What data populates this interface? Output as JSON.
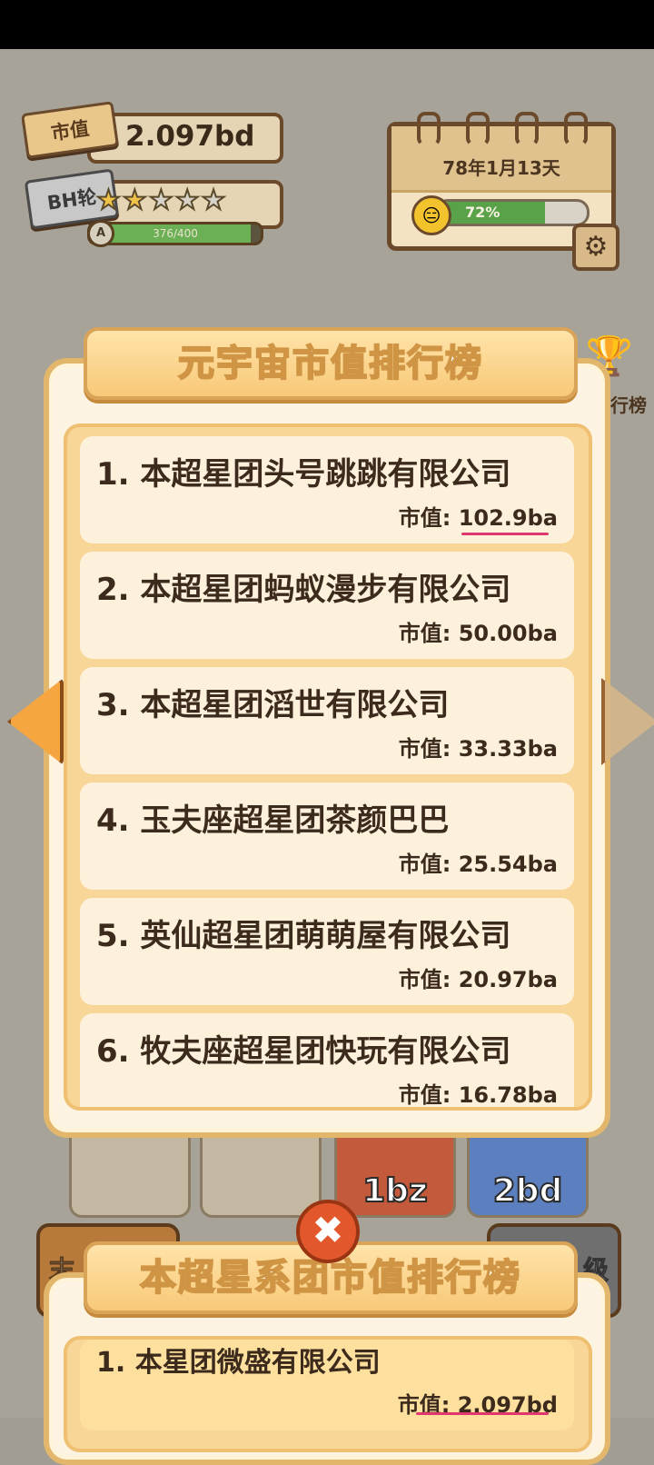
{
  "hud": {
    "cash_tag": "市值",
    "cash_value": "2.097bd",
    "rank_tag": "BH轮",
    "stars_filled": 2,
    "stars_total": 5,
    "level_badge": "A",
    "xp_text": "376/400",
    "xp_fraction": 0.94
  },
  "calendar": {
    "date": "78年1月13天",
    "mood_icon": "neutral-face-icon",
    "progress_text": "72%",
    "progress_fraction": 0.72
  },
  "side": {
    "ranking_label": "行榜"
  },
  "background_cells": [
    {
      "value": "1bz"
    },
    {
      "value": "2bd"
    }
  ],
  "bottom_strip": {
    "left_label": "末",
    "right_label": "级"
  },
  "universe_ranking": {
    "title": "元宇宙市值排行榜",
    "value_prefix": "市值: ",
    "entries": [
      {
        "name": "1. 本超星团头号跳跳有限公司",
        "value": "102.9ba"
      },
      {
        "name": "2. 本超星团蚂蚁漫步有限公司",
        "value": "50.00ba"
      },
      {
        "name": "3. 本超星团滔世有限公司",
        "value": "33.33ba"
      },
      {
        "name": "4. 玉夫座超星团茶颜巴巴",
        "value": "25.54ba"
      },
      {
        "name": "5. 英仙超星团萌萌屋有限公司",
        "value": "20.97ba"
      },
      {
        "name": "6. 牧夫座超星团快玩有限公司",
        "value": "16.78ba"
      }
    ]
  },
  "system_ranking": {
    "title": "本超星系团市值排行榜",
    "entries": [
      {
        "name": "1. 本星团微盛有限公司",
        "value_full": "市值: 2.097bd"
      }
    ]
  },
  "colors": {
    "accent": "#f8c978",
    "underline": "#e0386e"
  }
}
